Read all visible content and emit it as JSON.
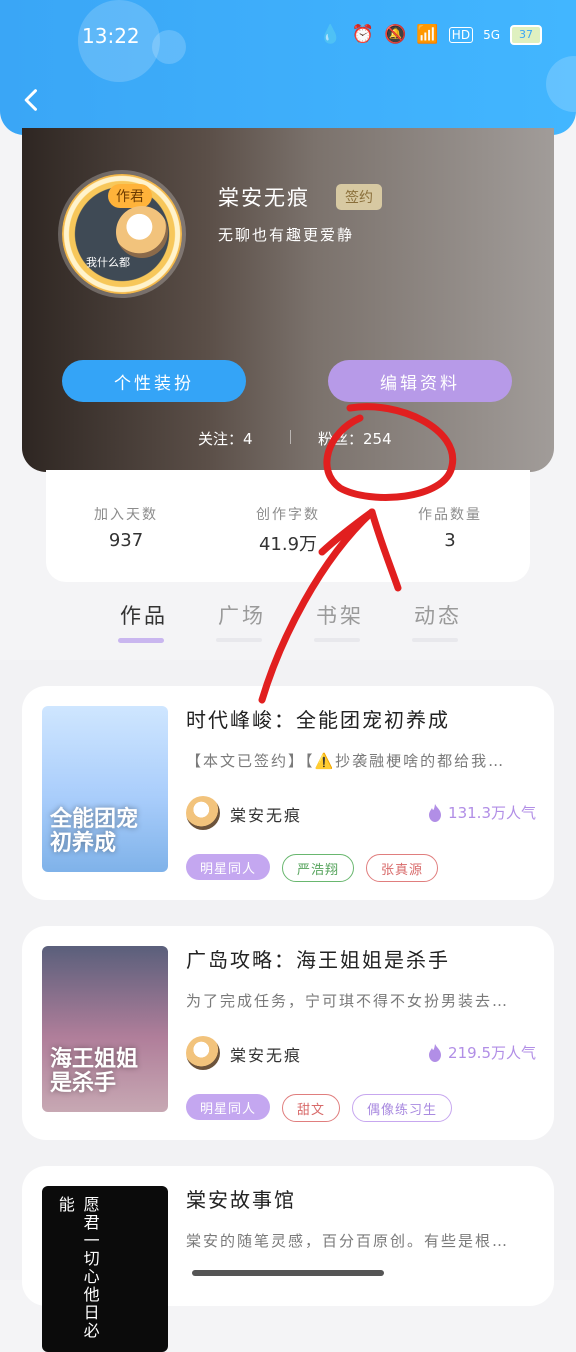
{
  "status_bar": {
    "time": "13:22",
    "icons": [
      "water-drop-icon",
      "alarm-icon",
      "mute-icon",
      "wifi-icon",
      "hd-icon",
      "5g-signal-icon"
    ],
    "battery": "37"
  },
  "colors": {
    "header": "#3aa6f6",
    "accent_purple": "#b79ae8",
    "accent_blue": "#34a4f7",
    "annotation_red": "#e11f1f"
  },
  "profile": {
    "avatar_badge": "作君",
    "avatar_caption": "我什么都",
    "name": "棠安无痕",
    "sign_badge": "签约",
    "bio": "无聊也有趣更爱静",
    "dress_button": "个性装扮",
    "edit_button": "编辑资料",
    "follow": "关注：4",
    "fans": "粉丝：254"
  },
  "stats": [
    {
      "label": "加入天数",
      "value": "937"
    },
    {
      "label": "创作字数",
      "value": "41.9万"
    },
    {
      "label": "作品数量",
      "value": "3"
    }
  ],
  "tabs": [
    "作品",
    "广场",
    "书架",
    "动态"
  ],
  "books": [
    {
      "cover_text": "全能团宠\n初养成",
      "title": "时代峰峻：全能团宠初养成",
      "desc": "【本文已签约】【⚠️抄袭融梗啥的都给我…",
      "author": "棠安无痕",
      "popularity": "131.3万人气",
      "tags": [
        "明星同人",
        "严浩翔",
        "张真源"
      ]
    },
    {
      "cover_text": "海王姐姐\n是杀手",
      "title": "广岛攻略：海王姐姐是杀手",
      "desc": "为了完成任务，宁可琪不得不女扮男装去…",
      "author": "棠安无痕",
      "popularity": "219.5万人气",
      "tags": [
        "明星同人",
        "甜文",
        "偶像练习生"
      ]
    },
    {
      "cover_text": "愿君一切心他日必能",
      "title": "棠安故事馆",
      "desc": "棠安的随笔灵感，百分百原创。有些是根…"
    }
  ]
}
